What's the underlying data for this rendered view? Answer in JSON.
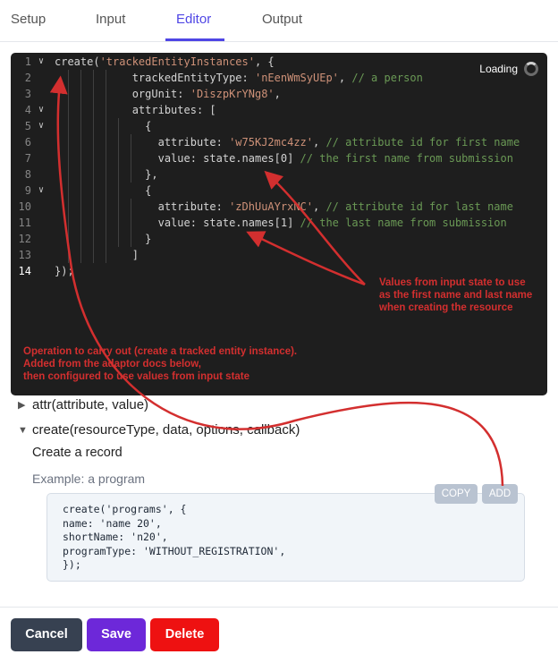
{
  "tabs": [
    {
      "label": "Setup"
    },
    {
      "label": "Input"
    },
    {
      "label": "Editor"
    },
    {
      "label": "Output"
    }
  ],
  "editor": {
    "loading_label": "Loading",
    "lines": [
      {
        "num": "1",
        "segs": [
          {
            "t": "create("
          },
          {
            "t": "'trackedEntityInstances'",
            "c": "str"
          },
          {
            "t": ", {"
          }
        ]
      },
      {
        "num": "2",
        "segs": [
          {
            "t": "            trackedEntityType: "
          },
          {
            "t": "'nEenWmSyUEp'",
            "c": "str"
          },
          {
            "t": ", "
          },
          {
            "t": "// a person",
            "c": "cmt"
          }
        ]
      },
      {
        "num": "3",
        "segs": [
          {
            "t": "            orgUnit: "
          },
          {
            "t": "'DiszpKrYNg8'",
            "c": "str"
          },
          {
            "t": ","
          }
        ]
      },
      {
        "num": "4",
        "segs": [
          {
            "t": "            attributes: ["
          }
        ]
      },
      {
        "num": "5",
        "segs": [
          {
            "t": "              {"
          }
        ]
      },
      {
        "num": "6",
        "segs": [
          {
            "t": "                attribute: "
          },
          {
            "t": "'w75KJ2mc4zz'",
            "c": "str"
          },
          {
            "t": ", "
          },
          {
            "t": "// attribute id for first name",
            "c": "cmt"
          }
        ]
      },
      {
        "num": "7",
        "segs": [
          {
            "t": "                value: state.names[0] "
          },
          {
            "t": "// the first name from submission",
            "c": "cmt"
          }
        ]
      },
      {
        "num": "8",
        "segs": [
          {
            "t": "              },"
          }
        ]
      },
      {
        "num": "9",
        "segs": [
          {
            "t": "              {"
          }
        ]
      },
      {
        "num": "10",
        "segs": [
          {
            "t": "                attribute: "
          },
          {
            "t": "'zDhUuAYrxNC'",
            "c": "str"
          },
          {
            "t": ", "
          },
          {
            "t": "// attribute id for last name",
            "c": "cmt"
          }
        ]
      },
      {
        "num": "11",
        "segs": [
          {
            "t": "                value: state.names[1] "
          },
          {
            "t": "// the last name from submission",
            "c": "cmt"
          }
        ]
      },
      {
        "num": "12",
        "segs": [
          {
            "t": "              }"
          }
        ]
      },
      {
        "num": "13",
        "segs": [
          {
            "t": "            ]"
          }
        ]
      },
      {
        "num": "14",
        "segs": [
          {
            "t": "});"
          }
        ]
      }
    ]
  },
  "annotations": {
    "values_note": "Values from input state to  use\nas the first name and last name\nwhen creating the resource",
    "operation_note": "Operation to carry out (create a tracked entity instance).\nAdded from the adaptor docs below,\nthen configured to use values from input state"
  },
  "docs": {
    "attr_signature": "attr(attribute, value)",
    "create_signature": "create(resourceType, data, options, callback)",
    "create_description": "Create a record",
    "example_label": "Example: a program",
    "example_code": "create('programs', {\nname: 'name 20',\nshortName: 'n20',\nprogramType: 'WITHOUT_REGISTRATION',\n});",
    "copy_label": "COPY",
    "add_label": "ADD"
  },
  "footer": {
    "cancel_label": "Cancel",
    "save_label": "Save",
    "delete_label": "Delete"
  },
  "colors": {
    "accent": "#4f46e5",
    "save": "#6d28d9",
    "delete": "#ee1111",
    "cancel": "#374151",
    "annotation": "#d32f2f",
    "editor_bg": "#1e1e1e"
  }
}
